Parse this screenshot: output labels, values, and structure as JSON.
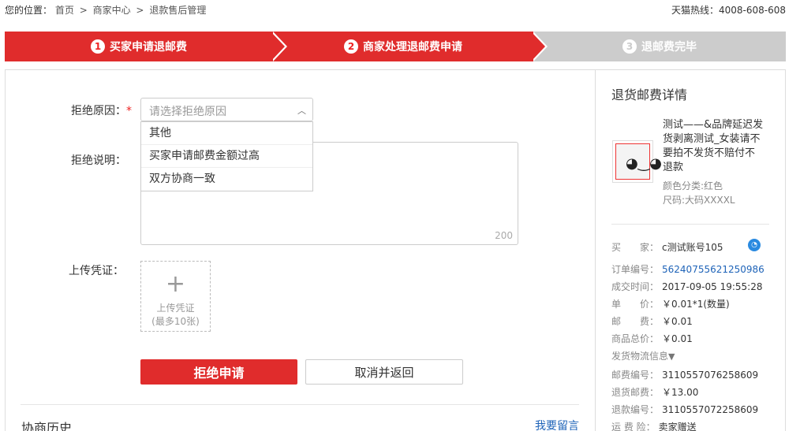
{
  "breadcrumb": {
    "prefix": "您的位置：",
    "items": [
      "首页",
      "商家中心",
      "退款售后管理"
    ],
    "separator": ">"
  },
  "hotline": "天猫热线：4008-608-608",
  "steps": [
    {
      "num": "1",
      "label": "买家申请退邮费",
      "state": "done"
    },
    {
      "num": "2",
      "label": "商家处理退邮费申请",
      "state": "active"
    },
    {
      "num": "3",
      "label": "退邮费完毕",
      "state": "pending"
    }
  ],
  "form": {
    "reason_label": "拒绝原因：",
    "required_mark": "*",
    "reason_placeholder": "请选择拒绝原因",
    "reason_options": [
      "其他",
      "买家申请邮费金额过高",
      "双方协商一致"
    ],
    "desc_label": "拒绝说明：",
    "desc_count": "200",
    "upload_label": "上传凭证：",
    "upload_title": "上传凭证",
    "upload_limit": "(最多10张)",
    "reject_button": "拒绝申请",
    "cancel_button": "取消并返回"
  },
  "history": {
    "title": "协商历史",
    "leave_message": "我要留言"
  },
  "detail": {
    "title": "退货邮费详情",
    "product_name": "测试——&品牌延迟发货剥离测试_女装请不要拍不发货不赔付不退款",
    "color": "颜色分类:红色",
    "size": "尺码:大码XXXXL",
    "rows": [
      {
        "label": "买　　家：",
        "value": "c测试账号105"
      },
      {
        "label": "订单编号：",
        "value": "56240755621250986"
      },
      {
        "label": "成交时间：",
        "value": "2017-09-05 19:55:28"
      },
      {
        "label": "单　　价：",
        "value": "￥0.01*1(数量)"
      },
      {
        "label": "邮　　费：",
        "value": "￥0.01"
      },
      {
        "label": "商品总价：",
        "value": "￥0.01"
      },
      {
        "label": "发货物流信息",
        "value": "▼"
      },
      {
        "label": "邮费编号：",
        "value": "3110557076258609"
      },
      {
        "label": "退货邮费：",
        "value": "￥13.00"
      },
      {
        "label": "退款编号：",
        "value": "3110557072258609"
      },
      {
        "label": "运 费 险：",
        "value": "卖家赠送"
      }
    ]
  }
}
